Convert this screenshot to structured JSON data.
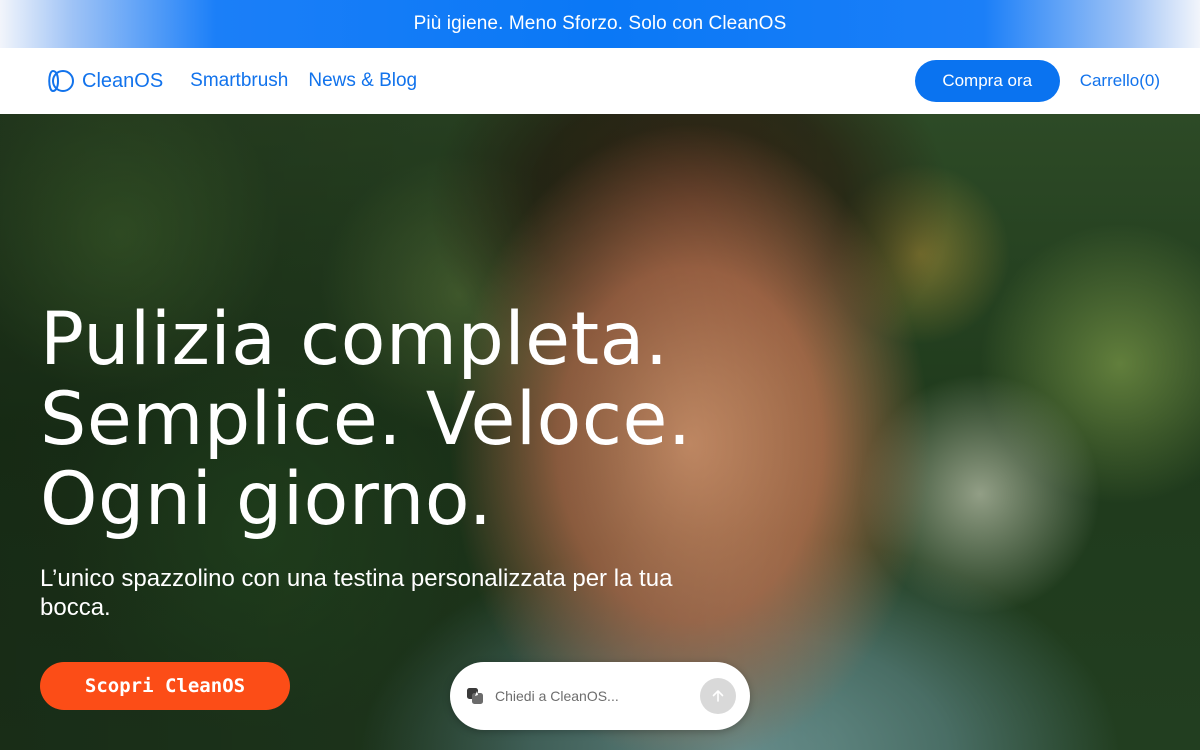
{
  "announcement": {
    "text": "Più igiene. Meno Sforzo. Solo con CleanOS"
  },
  "header": {
    "logo_text": "CleanOS",
    "logo_icon": "cleanos-logo-icon",
    "nav": [
      {
        "label": "Smartbrush"
      },
      {
        "label": "News & Blog"
      }
    ],
    "buy_label": "Compra ora",
    "cart_label": "Carrello(0)",
    "cart_count": 0
  },
  "hero": {
    "headline_lines": [
      "Pulizia completa.",
      "Semplice. Veloce.",
      "Ogni giorno."
    ],
    "subhead": "L’unico spazzolino con una testina personalizzata per la tua bocca.",
    "cta_label": "Scopri CleanOS",
    "background": "photo-smiling-man-outdoors",
    "ask": {
      "placeholder": "Chiedi a CleanOS...",
      "icon": "chat-ai-icon",
      "send_icon": "arrow-up-icon"
    }
  },
  "colors": {
    "brand_blue": "#0a73f0",
    "cta_orange": "#fc4d17",
    "white": "#ffffff"
  }
}
